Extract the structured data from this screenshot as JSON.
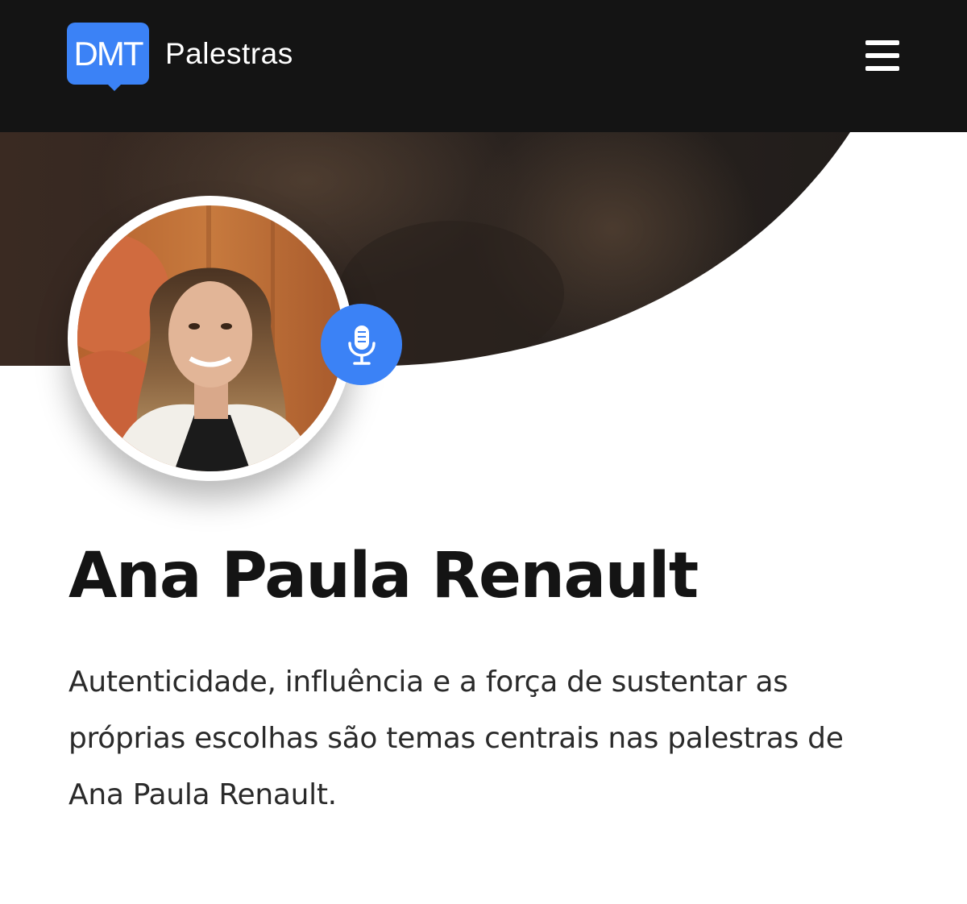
{
  "header": {
    "logo_mark": "DMT",
    "logo_text": "Palestras",
    "menu_icon": "hamburger-menu-icon"
  },
  "profile": {
    "name": "Ana Paula Renault",
    "bio": "Autenticidade, influência e a força de sustentar as próprias escolhas são temas centrais nas palestras de Ana Paula Renault.",
    "badge_icon": "microphone-icon"
  },
  "colors": {
    "header_bg": "#141414",
    "accent": "#3b82f6",
    "text_dark": "#141414",
    "text_body": "#2a2a2a"
  }
}
